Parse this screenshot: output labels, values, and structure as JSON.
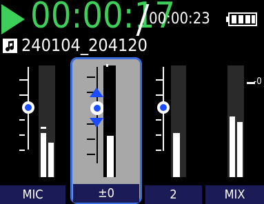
{
  "status": {
    "elapsed": "00:00:17",
    "total": "00:00:23",
    "play_state": "play-icon",
    "battery_icon": "battery-icon",
    "accent_color": "#3ecf5a"
  },
  "file": {
    "name": "240104_204120",
    "icon": "music-note-file-icon"
  },
  "channels": [
    {
      "label": "MIC",
      "selected": false
    },
    {
      "label": "±0",
      "selected": true
    },
    {
      "label": "2",
      "selected": false
    },
    {
      "label": "MIX",
      "selected": false,
      "level_marker": "-0"
    }
  ],
  "colors": {
    "label_bg": "#1b1c57",
    "selected_bg": "#a8a8a8",
    "selected_border": "#3b6fe0",
    "knob": "#1a4dff"
  }
}
